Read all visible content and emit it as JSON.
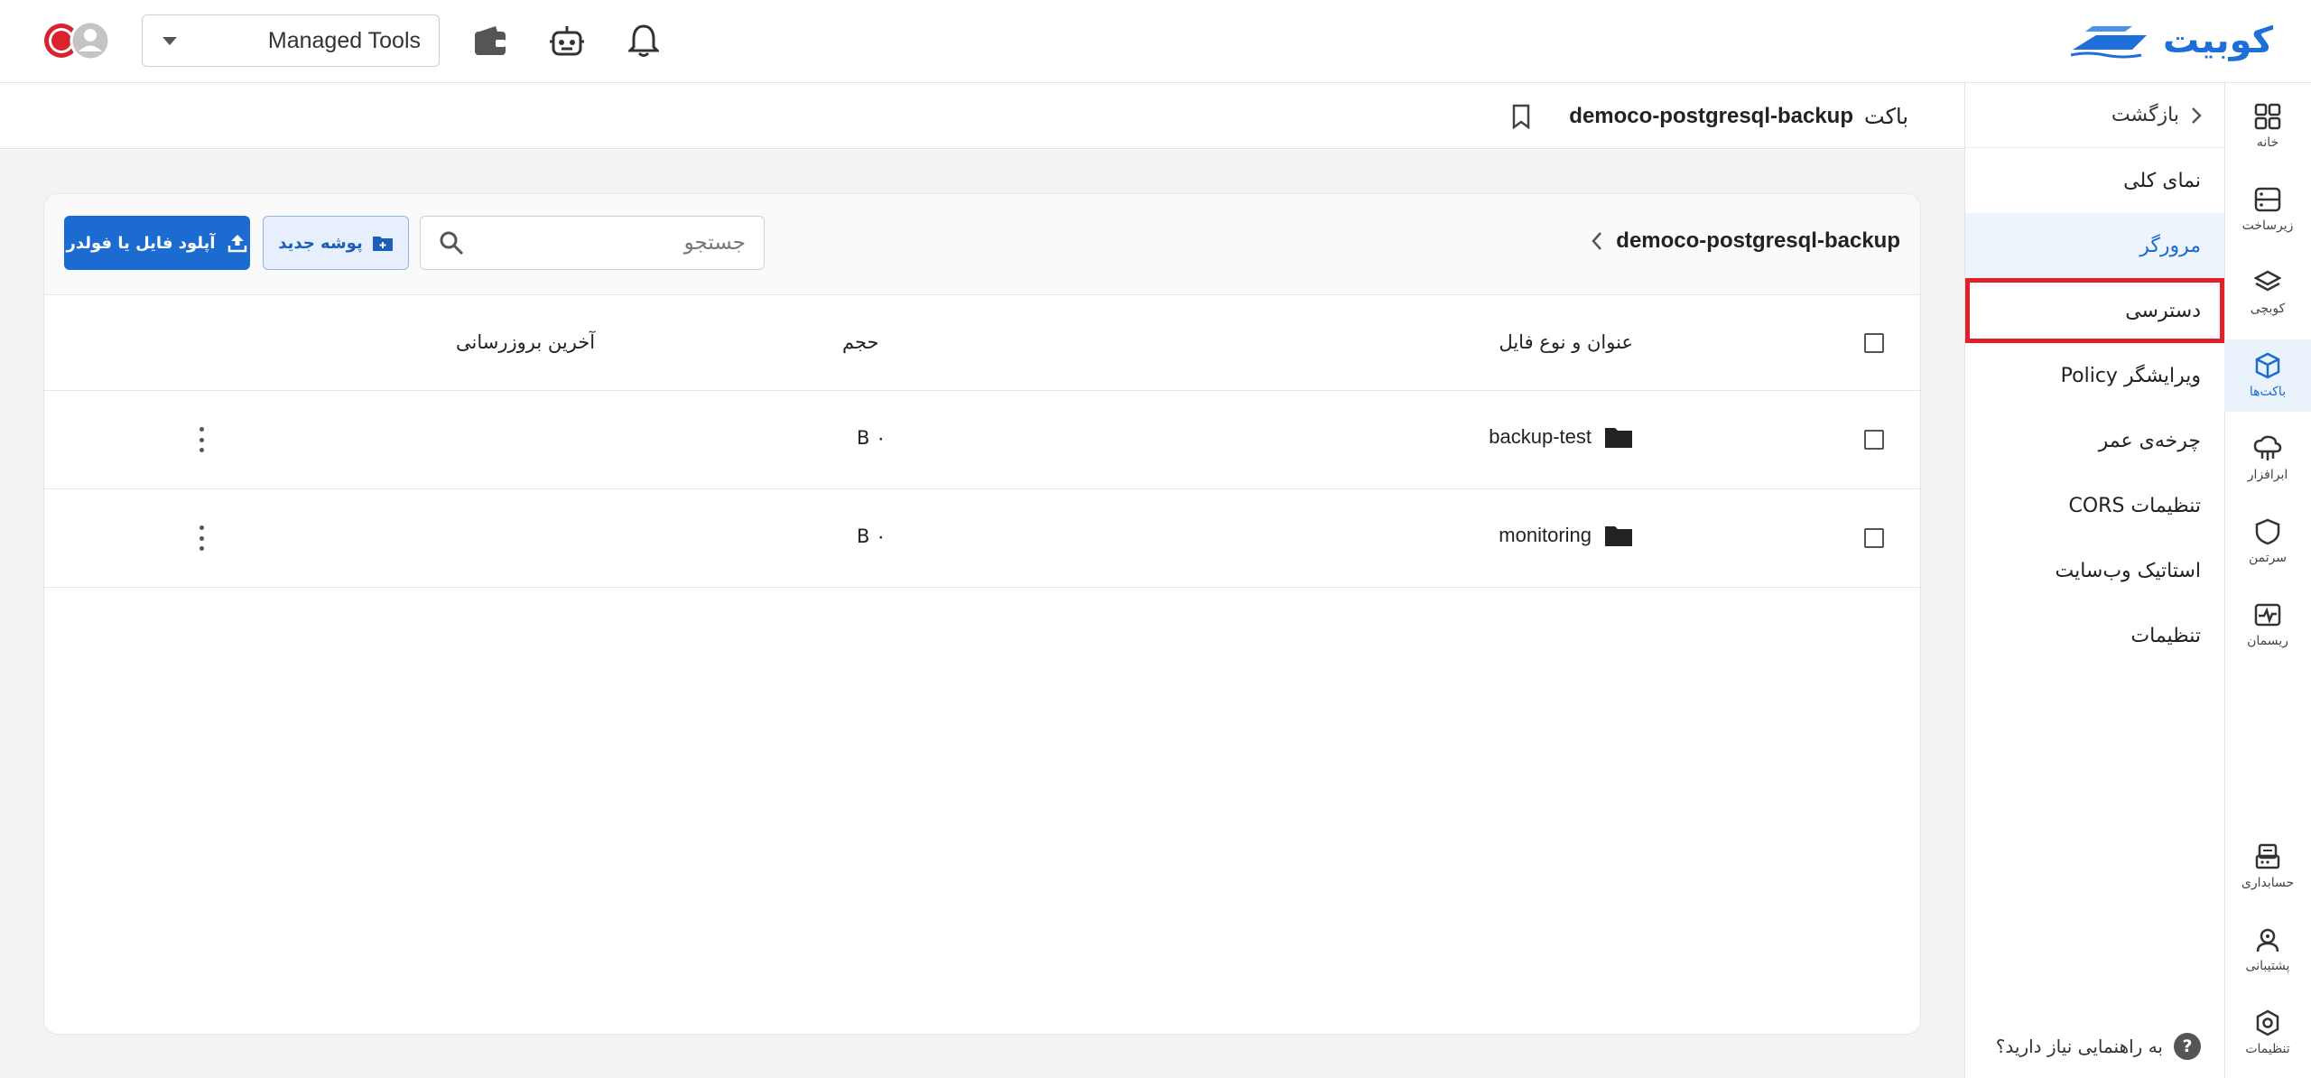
{
  "brand": {
    "name": "کوبیت",
    "color": "#1e6fd9"
  },
  "topbar": {
    "account_value": "Managed Tools",
    "icons": [
      "bell-icon",
      "robot-icon",
      "wallet-icon"
    ]
  },
  "rail": {
    "items": [
      {
        "label": "خانه",
        "icon": "grid-icon"
      },
      {
        "label": "زیرساخت",
        "icon": "server-icon"
      },
      {
        "label": "کوبچی",
        "icon": "layers-icon"
      },
      {
        "label": "باکت‌ها",
        "icon": "cube-icon"
      },
      {
        "label": "ابرافزار",
        "icon": "cloud-app-icon"
      },
      {
        "label": "سرتمن",
        "icon": "shield-icon"
      },
      {
        "label": "ریسمان",
        "icon": "pulse-icon"
      }
    ],
    "bottom_items": [
      {
        "label": "حسابداری",
        "icon": "invoice-icon"
      },
      {
        "label": "پشتیبانی",
        "icon": "support-icon"
      },
      {
        "label": "تنظیمات",
        "icon": "settings-icon"
      }
    ]
  },
  "subnav": {
    "back_label": "بازگشت",
    "items": [
      {
        "label": "نمای کلی"
      },
      {
        "label": "مرورگر"
      },
      {
        "label": "دسترسی"
      },
      {
        "label": "ویرایشگر Policy"
      },
      {
        "label": "چرخه‌ی عمر"
      },
      {
        "label": "تنظیمات CORS"
      },
      {
        "label": "استاتیک وب‌سایت"
      },
      {
        "label": "تنظیمات"
      }
    ],
    "help_label": "به راهنمایی نیاز دارید؟",
    "help_glyph": "?"
  },
  "page": {
    "kind_label": "باکت",
    "bucket_name": "democo-postgresql-backup"
  },
  "browser": {
    "crumb": "democo-postgresql-backup",
    "search_placeholder": "جستجو",
    "new_folder_label": "پوشه جدید",
    "upload_label": "آپلود فایل یا فولدر",
    "columns": {
      "name": "عنوان و نوع فایل",
      "size": "حجم",
      "updated": "آخرین بروزرسانی"
    },
    "rows": [
      {
        "name": "backup-test",
        "size": "۰ B",
        "updated": ""
      },
      {
        "name": "monitoring",
        "size": "۰ B",
        "updated": ""
      }
    ]
  }
}
